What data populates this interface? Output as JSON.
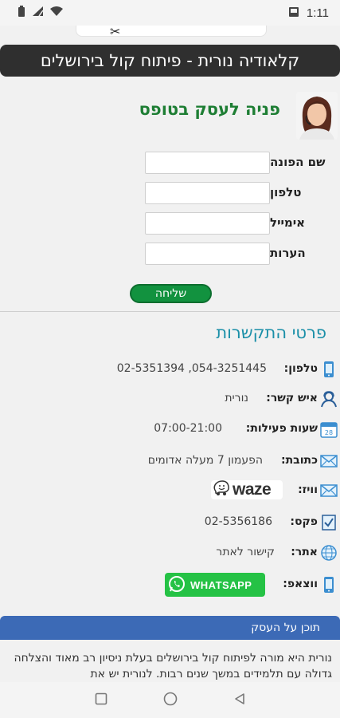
{
  "status_bar": {
    "time": "1:11"
  },
  "header": {
    "title": "קלאודיה נורית - פיתוח קול בירושלים"
  },
  "form": {
    "title": "פניה לעסק בטופס",
    "fields": [
      {
        "label": "שם הפונה",
        "value": ""
      },
      {
        "label": "טלפון",
        "value": ""
      },
      {
        "label": "אימייל",
        "value": ""
      },
      {
        "label": "הערות",
        "value": ""
      }
    ],
    "submit_label": "שליחה"
  },
  "contact": {
    "title": "פרטי התקשרות",
    "phone_label": "טלפון:",
    "phone_value": "054-3251445, 02-5351394",
    "person_label": "איש קשר:",
    "person_value": "נורית",
    "hours_label": "שעות פעילות:",
    "hours_value": "07:00-21:00",
    "address_label": "כתובת:",
    "address_value": "הפעמון 7 מעלה אדומים",
    "waze_label": "וויז:",
    "waze_text": "waze",
    "fax_label": "פקס:",
    "fax_value": "02-5356186",
    "site_label": "אתר:",
    "site_value": "קישור לאתר",
    "whatsapp_label": "ווצאפ:",
    "whatsapp_button": "WHATSAPP"
  },
  "about": {
    "title": "תוכן על העסק",
    "text": "נורית היא מורה לפיתוח קול בירושלים בעלת ניסיון רב מאוד והצלחה גדולה עם תלמידים במשך שנים רבות. לנורית יש את"
  },
  "colors": {
    "header_bg": "#2f2f2f",
    "form_title": "#1e7e34",
    "submit_bg": "#12923f",
    "contact_title": "#1a8fa8",
    "about_header_bg": "#3c6ab6",
    "whatsapp_bg": "#25c245"
  }
}
